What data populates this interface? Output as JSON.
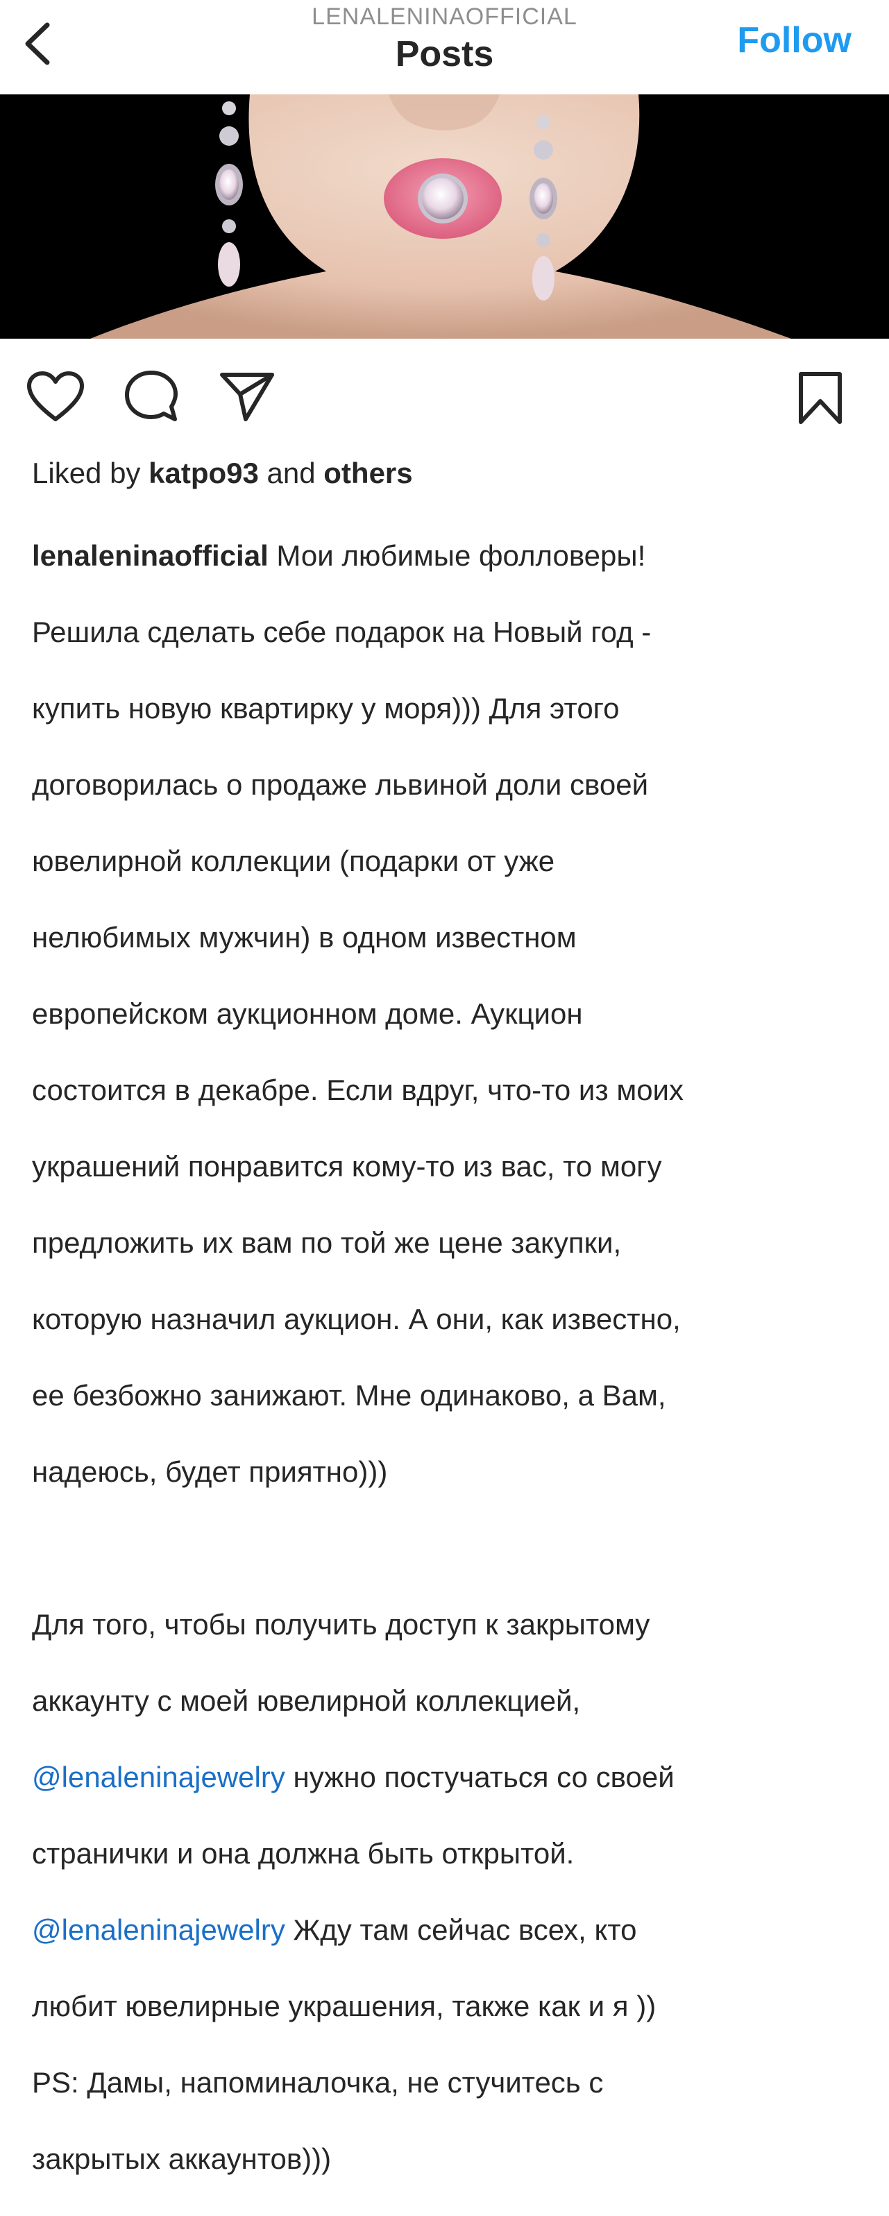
{
  "header": {
    "username": "LENALENINAOFFICIAL",
    "title": "Posts",
    "follow_label": "Follow"
  },
  "post": {
    "likes": {
      "prefix": "Liked by ",
      "user": "katpo93",
      "middle": " and ",
      "suffix": "others"
    },
    "caption": {
      "username": "lenaleninaofficial",
      "p1_l1": " Мои любимые фолловеры!",
      "p1_l2": "Решила сделать себе подарок на Новый год -",
      "p1_l3": "купить новую квартирку у моря))) Для этого",
      "p1_l4": "договорилась о продаже львиной доли своей",
      "p1_l5": "ювелирной коллекции (подарки от уже",
      "p1_l6": "нелюбимых мужчин) в одном известном",
      "p1_l7": "европейском аукционном доме. Аукцион",
      "p1_l8": "состоится в декабре. Если вдруг, что-то из моих",
      "p1_l9": "украшений понравится кому-то из вас, то могу",
      "p1_l10": "предложить их вам по той же цене закупки,",
      "p1_l11": "которую назначил аукцион. А они, как известно,",
      "p1_l12": "ее безбожно занижают. Мне одинаково, а Вам,",
      "p1_l13": "надеюсь, будет приятно)))",
      "p2_l1": "Для того, чтобы получить доступ к закрытому",
      "p2_l2": "аккаунту с моей ювелирной коллекцией,",
      "mention": "@lenaleninajewelry",
      "p2_l3_rest": " нужно постучаться со своей",
      "p2_l4": "странички и она должна быть открытой.",
      "p2_l5_rest": " Жду там сейчас всех, кто",
      "p2_l6": "любит ювелирные украшения, также как и я ))",
      "p2_l7": "PS: Дамы, напоминалочка, не стучитесь с",
      "p2_l8": "закрытых аккаунтов)))"
    }
  },
  "icons": {
    "back": "chevron-left-icon",
    "like": "heart-icon",
    "comment": "comment-icon",
    "share": "paper-plane-icon",
    "save": "bookmark-icon"
  },
  "colors": {
    "link": "#1a6fc7",
    "follow": "#1e9bf0",
    "text": "#262626",
    "muted": "#8e8e8e"
  }
}
